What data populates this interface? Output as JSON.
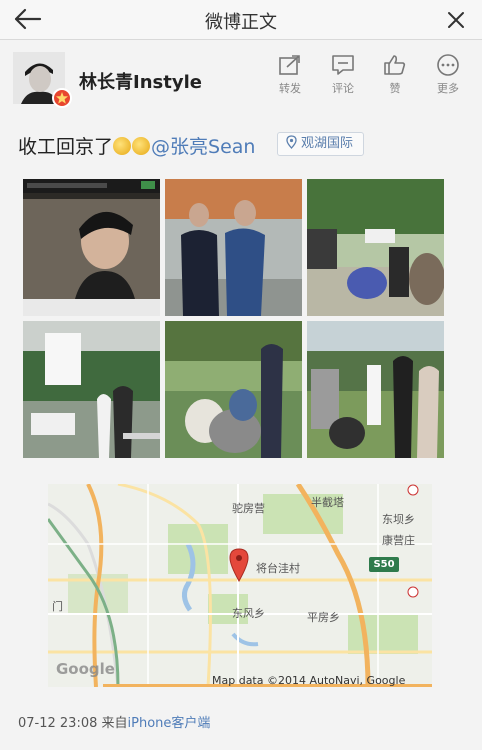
{
  "nav": {
    "title": "微博正文"
  },
  "author": {
    "name": "林长青Instyle"
  },
  "actions": [
    {
      "label": "转发",
      "icon": "share-icon"
    },
    {
      "label": "评论",
      "icon": "comment-icon"
    },
    {
      "label": "赞",
      "icon": "thumbs-up-icon"
    },
    {
      "label": "更多",
      "icon": "more-icon"
    }
  ],
  "post": {
    "text": "收工回京了",
    "mention": "@张亮Sean",
    "location": "观湖国际"
  },
  "map": {
    "labels": [
      "驼房营",
      "半截塔",
      "东坝乡",
      "康营庄",
      "将台洼村",
      "东风乡",
      "平房乡",
      "门"
    ],
    "highway": "S50",
    "attribution": "Map data ©2014 AutoNavi, Google",
    "google": "Google"
  },
  "footer": {
    "time": "07-12 23:08",
    "from": "来自",
    "source": "iPhone客户端"
  },
  "colors": {
    "link": "#4f7cb8",
    "accent": "#e8462f"
  }
}
